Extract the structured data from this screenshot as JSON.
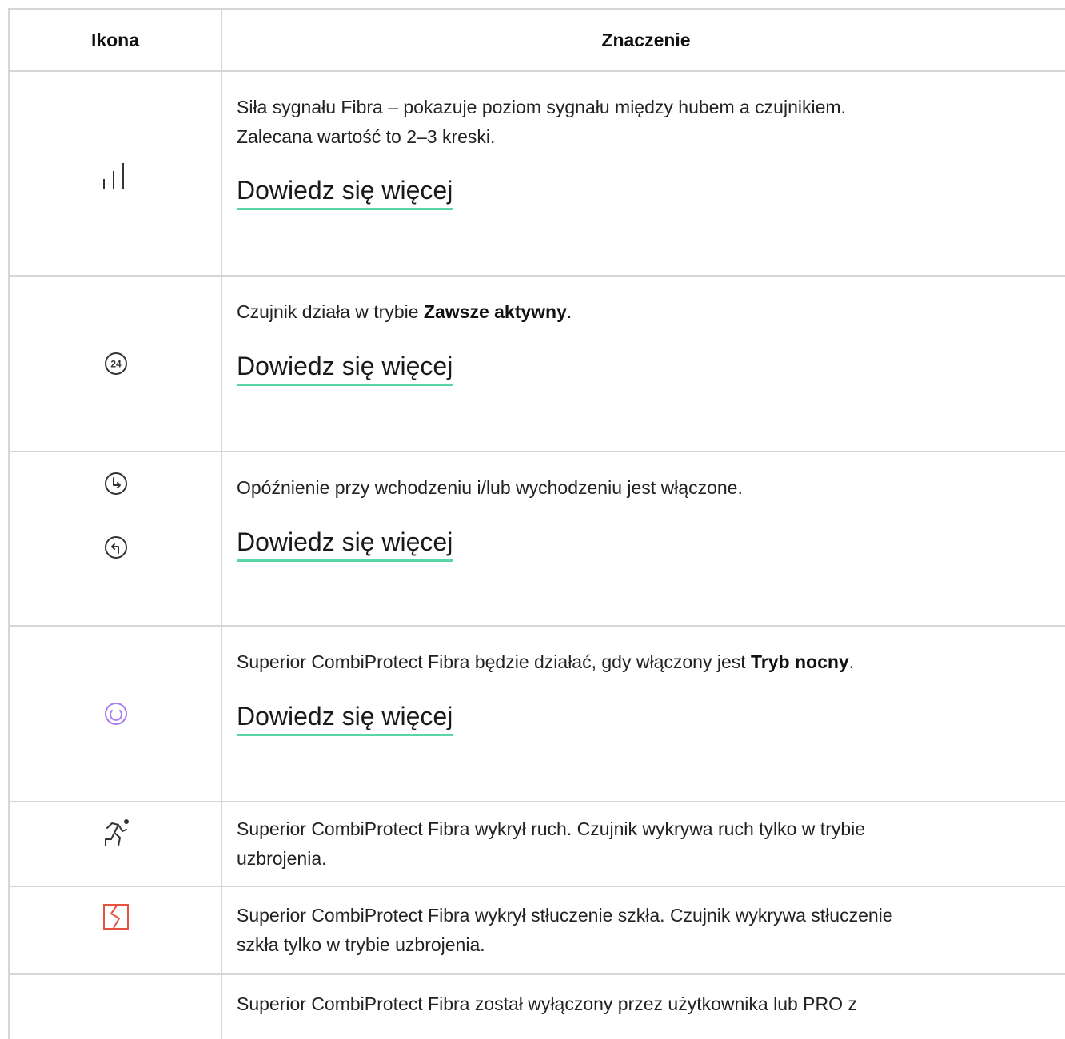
{
  "header": {
    "icon_col": "Ikona",
    "meaning_col": "Znaczenie"
  },
  "link_label": "Dowiedz się więcej",
  "rows": [
    {
      "icon": "signal-bars-icon",
      "text_line1": "Siła sygnału Fibra – pokazuje poziom sygnału między hubem a czujnikiem.",
      "text_line2": "Zalecana wartość to 2–3 kreski."
    },
    {
      "icon": "always-active-24-icon",
      "badge": "24",
      "text_pre": "Czujnik działa w trybie ",
      "text_bold": "Zawsze aktywny",
      "text_post": "."
    },
    {
      "icon": "entry-exit-delay-icon",
      "text": "Opóźnienie przy wchodzeniu i/lub wychodzeniu jest włączone."
    },
    {
      "icon": "night-mode-icon",
      "text_pre": "Superior CombiProtect Fibra będzie działać, gdy włączony jest ",
      "text_bold": "Tryb nocny",
      "text_post": "."
    },
    {
      "icon": "motion-detected-icon",
      "text_line1": "Superior CombiProtect Fibra wykrył ruch. Czujnik wykrywa ruch tylko w trybie",
      "text_line2": "uzbrojenia."
    },
    {
      "icon": "glass-break-icon",
      "text_line1": "Superior CombiProtect Fibra wykrył stłuczenie szkła. Czujnik wykrywa stłuczenie",
      "text_line2": "szkła tylko w trybie uzbrojenia."
    },
    {
      "icon": "",
      "text_line1": "Superior CombiProtect Fibra został wyłączony przez użytkownika lub PRO z"
    }
  ],
  "colors": {
    "link_underline": "#5ad6a6",
    "night_icon": "#a97cf2",
    "glass_icon": "#e5523f",
    "border": "#d6d6d6"
  }
}
